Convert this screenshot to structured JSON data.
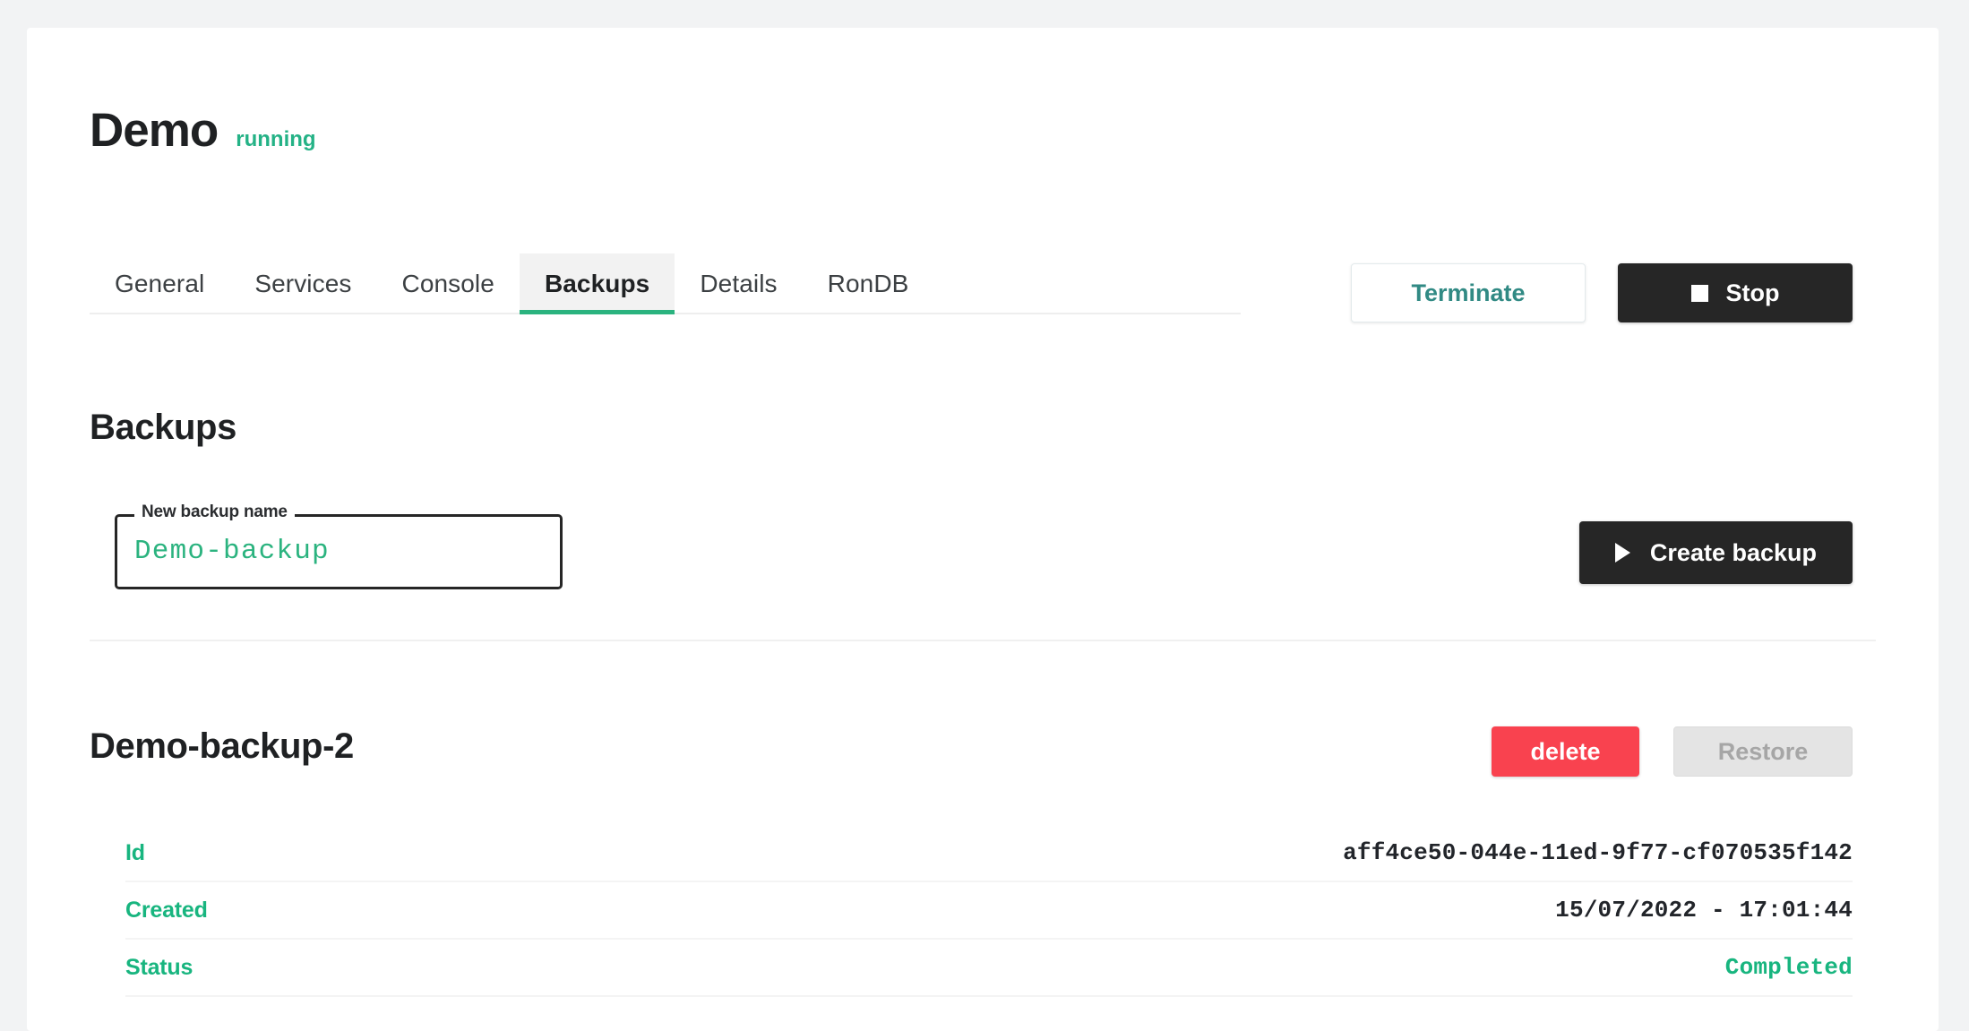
{
  "cluster": {
    "name": "Demo",
    "status": "running"
  },
  "tabs": [
    {
      "label": "General",
      "active": false
    },
    {
      "label": "Services",
      "active": false
    },
    {
      "label": "Console",
      "active": false
    },
    {
      "label": "Backups",
      "active": true
    },
    {
      "label": "Details",
      "active": false
    },
    {
      "label": "RonDB",
      "active": false
    }
  ],
  "header_actions": {
    "terminate_label": "Terminate",
    "stop_label": "Stop",
    "stop_icon": "square-icon"
  },
  "backups_section": {
    "heading": "Backups",
    "new_backup_field": {
      "label": "New backup name",
      "value": "Demo-backup",
      "placeholder": "New backup name"
    },
    "create_button": {
      "label": "Create backup",
      "icon": "play-icon"
    }
  },
  "backup_item": {
    "name": "Demo-backup-2",
    "delete_label": "delete",
    "restore_label": "Restore",
    "details": [
      {
        "label": "Id",
        "value": "aff4ce50-044e-11ed-9f77-cf070535f142",
        "status": false
      },
      {
        "label": "Created",
        "value": "15/07/2022 - 17:01:44",
        "status": false
      },
      {
        "label": "Status",
        "value": "Completed",
        "status": true
      }
    ]
  },
  "colors": {
    "accent_green": "#18b57f",
    "status_green": "#24b286",
    "danger_red": "#f9424f",
    "dark": "#262626",
    "terminate_text": "#318a84",
    "page_bg": "#f2f3f4"
  }
}
